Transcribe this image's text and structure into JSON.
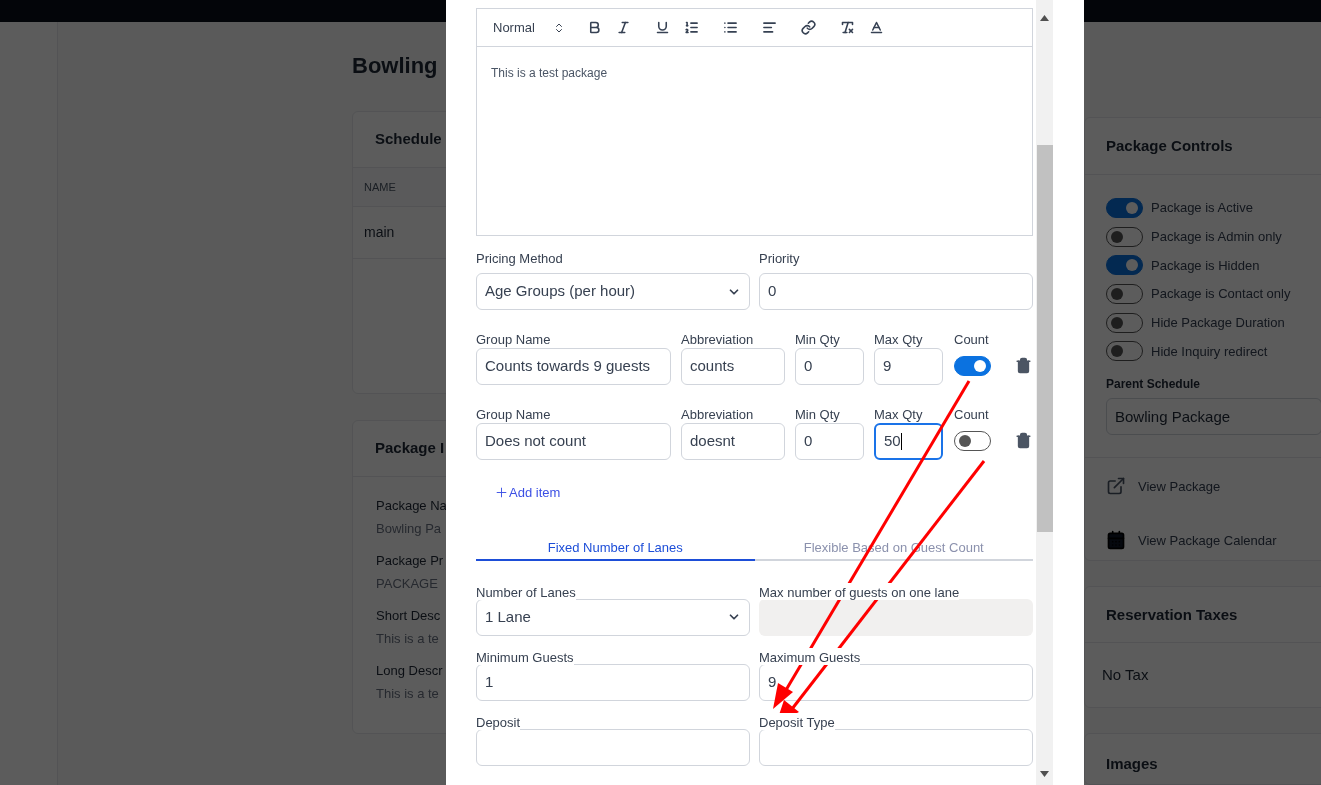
{
  "page": {
    "title": "Bowling",
    "schedule_card": {
      "title": "Schedule",
      "columns": [
        "NAME"
      ],
      "rows": [
        [
          "main"
        ]
      ]
    },
    "info_card": {
      "title": "Package I",
      "fields": [
        {
          "label": "Package Na",
          "value": "Bowling Pa",
          "kind": "plain"
        },
        {
          "label": "Package Pr",
          "value": "PACKAGE",
          "kind": "plain"
        },
        {
          "label": "Short Desc",
          "value": "This is a te",
          "kind": "plain"
        },
        {
          "label": "Long Descr",
          "value": "This is a te",
          "kind": "plain"
        }
      ]
    }
  },
  "side_panel": {
    "controls_title": "Package Controls",
    "toggles": [
      {
        "label": "Package is Active",
        "on": true
      },
      {
        "label": "Package is Admin only",
        "on": false
      },
      {
        "label": "Package is Hidden",
        "on": true
      },
      {
        "label": "Package is Contact only",
        "on": false
      },
      {
        "label": "Hide Package Duration",
        "on": false
      },
      {
        "label": "Hide Inquiry redirect",
        "on": false
      }
    ],
    "parent_schedule": {
      "label": "Parent Schedule",
      "value": "Bowling Package"
    },
    "links": [
      {
        "label": "View Package",
        "kind": "external"
      },
      {
        "label": "View Package Calendar",
        "kind": "calendar"
      }
    ],
    "taxes_title": "Reservation Taxes",
    "tax": "No Tax",
    "images_title": "Images"
  },
  "modal": {
    "editor": {
      "format": "Normal",
      "text": "This is a test package"
    },
    "pricing_method": {
      "label": "Pricing Method",
      "value": "Age Groups (per hour)"
    },
    "priority": {
      "label": "Priority",
      "value": "0"
    },
    "groups": [
      {
        "fields": [
          {
            "label": "Group Name",
            "value": "Counts towards 9 guests",
            "focused": false
          },
          {
            "label": "Abbreviation",
            "value": "counts",
            "focused": false
          },
          {
            "label": "Min Qty",
            "value": "0",
            "focused": false
          },
          {
            "label": "Max Qty",
            "value": "9",
            "focused": false
          }
        ],
        "count_label": "Count",
        "count": true
      },
      {
        "fields": [
          {
            "label": "Group Name",
            "value": "Does not count",
            "focused": false
          },
          {
            "label": "Abbreviation",
            "value": "doesnt",
            "focused": false
          },
          {
            "label": "Min Qty",
            "value": "0",
            "focused": false
          },
          {
            "label": "Max Qty",
            "value": "50",
            "focused": true
          }
        ],
        "count_label": "Count",
        "count": false
      }
    ],
    "add_item": "Add item",
    "lane_tabs": [
      {
        "label": "Fixed Number of Lanes",
        "selected": true
      },
      {
        "label": "Flexible Based on Guest Count",
        "selected": false
      }
    ],
    "fields": [
      {
        "label": "Number of Lanes",
        "value": "1 Lane",
        "kind": "select",
        "disabled": false
      },
      {
        "label": "Max number of guests on one lane",
        "kind": "text",
        "disabled": true
      },
      {
        "label": "Minimum Guests",
        "value": "1",
        "kind": "text",
        "disabled": false
      },
      {
        "label": "Maximum Guests",
        "value": "9",
        "kind": "text",
        "disabled": false
      },
      {
        "label": "Deposit",
        "kind": "text",
        "disabled": false
      },
      {
        "label": "Deposit Type",
        "kind": "text",
        "disabled": false
      }
    ]
  }
}
